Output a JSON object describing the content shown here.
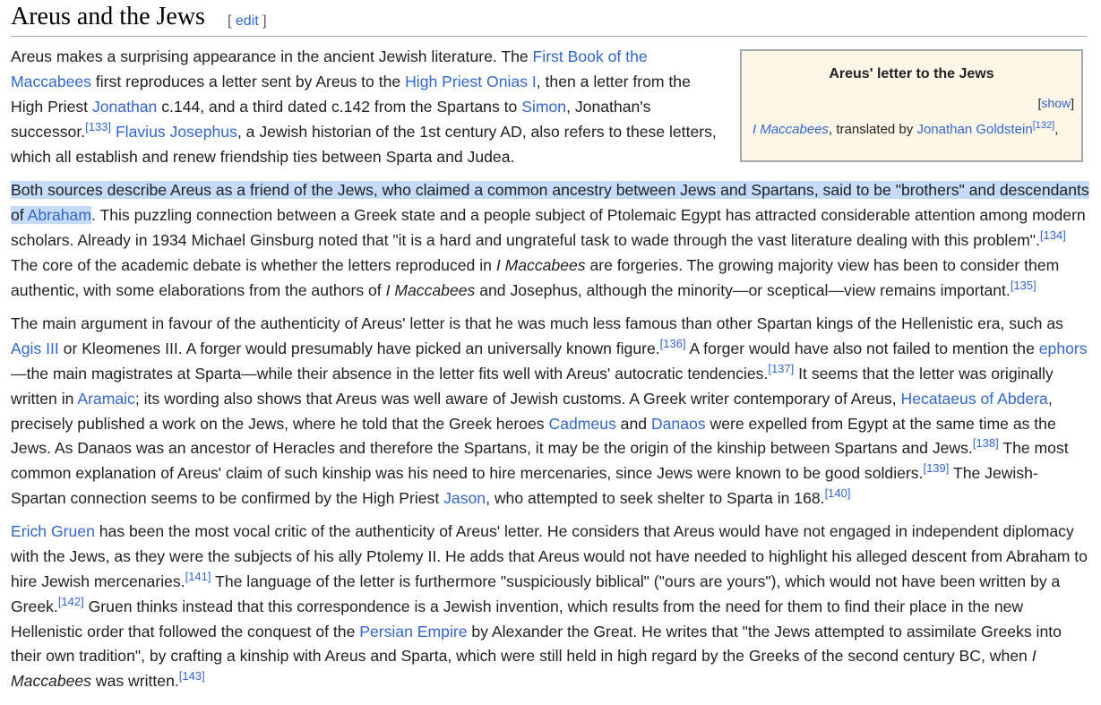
{
  "heading": {
    "title": "Areus and the Jews",
    "edit_open": "[",
    "edit_label": "edit",
    "edit_close": "]"
  },
  "quote_box": {
    "title": "Areus' letter to the Jews",
    "toggle_open": "[",
    "toggle_label": "show",
    "toggle_close": "]",
    "work": "I Maccabees",
    "translated_by": ", translated by ",
    "translator": "Jonathan Goldstein",
    "ref": "[132]",
    "trail": ","
  },
  "p1": {
    "l1": {
      "t1": "Areus makes a surprising appearance in the ancient Jewish literature. The ",
      "a1": "First Book of the"
    },
    "l2": {
      "a1": "Maccabees",
      "t1": " first reproduces a letter sent by Areus to the ",
      "a2": "High Priest Onias I",
      "t2": ", then a letter from the"
    },
    "l3": {
      "t1": "High Priest ",
      "a1": "Jonathan",
      "t2": " c.144, and a third dated c.142 from the Spartans to ",
      "a2": "Simon",
      "t3": ", Jonathan's"
    },
    "l4": {
      "t1": "successor.",
      "r1": "[133]",
      "t2": " ",
      "a1": "Flavius Josephus",
      "t3": ", a Jewish historian of the 1st century AD, also refers to these letters,"
    },
    "l5": {
      "t1": "which all establish and renew friendship ties between Sparta and Judea."
    }
  },
  "p2": {
    "l1": {
      "t1": "Both sources describe Areus as a friend of the Jews, who claimed a common ancestry between Jews and Spartans, said to be \"brothers\" and descendants"
    },
    "l2": {
      "t1": "of ",
      "a1": "Abraham",
      "t2": ". This puzzling connection between a Greek state and a people subject of Ptolemaic Egypt has attracted considerable attention among modern"
    },
    "l3": {
      "t1": "scholars. Already in 1934 Michael Ginsburg noted that \"it is a hard and ungrateful task to wade through the vast literature dealing with this problem\".",
      "r1": "[134]"
    },
    "l4": {
      "t1": "The core of the academic debate is whether the letters reproduced in ",
      "i1": "I Maccabees",
      "t2": " are forgeries. The growing majority view has been to consider them"
    },
    "l5": {
      "t1": "authentic, with some elaborations from the authors of ",
      "i1": "I Maccabees",
      "t2": " and Josephus, although the minority—or sceptical—view remains important.",
      "r1": "[135]"
    }
  },
  "p3": {
    "l1": {
      "t1": "The main argument in favour of the authenticity of Areus' letter is that he was much less famous than other Spartan kings of the Hellenistic era, such as"
    },
    "l2": {
      "a1": "Agis III",
      "t1": " or Kleomenes III. A forger would presumably have picked an universally known figure.",
      "r1": "[136]",
      "t2": " A forger would have also not failed to mention the ",
      "a2": "ephors"
    },
    "l3": {
      "t1": "—the main magistrates at Sparta—while their absence in the letter fits well with Areus' autocratic tendencies.",
      "r1": "[137]",
      "t2": " It seems that the letter was originally"
    },
    "l4": {
      "t1": "written in ",
      "a1": "Aramaic",
      "t2": "; its wording also shows that Areus was well aware of Jewish customs. A Greek writer contemporary of Areus, ",
      "a2": "Hecataeus of Abdera",
      "t3": ","
    },
    "l5": {
      "t1": "precisely published a work on the Jews, where he told that the Greek heroes ",
      "a1": "Cadmeus",
      "t2": " and ",
      "a2": "Danaos",
      "t3": " were expelled from Egypt at the same time as the"
    },
    "l6": {
      "t1": "Jews. As Danaos was an ancestor of Heracles and therefore the Spartans, it may be the origin of the kinship between Spartans and Jews.",
      "r1": "[138]",
      "t2": " The most"
    },
    "l7": {
      "t1": "common explanation of Areus' claim of such kinship was his need to hire mercenaries, since Jews were known to be good soldiers.",
      "r1": "[139]",
      "t2": " The Jewish-"
    },
    "l8": {
      "t1": "Spartan connection seems to be confirmed by the High Priest ",
      "a1": "Jason",
      "t2": ", who attempted to seek shelter to Sparta in 168.",
      "r1": "[140]"
    }
  },
  "p4": {
    "l1": {
      "a1": "Erich Gruen",
      "t1": " has been the most vocal critic of the authenticity of Areus' letter. He considers that Areus would have not engaged in independent diplomacy"
    },
    "l2": {
      "t1": "with the Jews, as they were the subjects of his ally Ptolemy II. He adds that Areus would not have needed to highlight his alleged descent from Abraham to"
    },
    "l3": {
      "t1": "hire Jewish mercenaries.",
      "r1": "[141]",
      "t2": " The language of the letter is furthermore \"suspiciously biblical\" (\"ours are yours\"), which would not have been written by a"
    },
    "l4": {
      "t1": "Greek.",
      "r1": "[142]",
      "t2": " Gruen thinks instead that this correspondence is a Jewish invention, which results from the need for them to find their place in the new"
    },
    "l5": {
      "t1": "Hellenistic order that followed the conquest of the ",
      "a1": "Persian Empire",
      "t2": " by Alexander the Great. He writes that \"the Jews attempted to assimilate Greeks into"
    },
    "l6": {
      "t1": "their own tradition\", by crafting a kinship with Areus and Sparta, which were still held in high regard by the Greeks of the second century BC, when ",
      "i1": "I"
    },
    "l7": {
      "i1": "Maccabees",
      "t1": " was written.",
      "r1": "[143]"
    }
  },
  "colors": {
    "link": "#3366cc",
    "text": "#202122",
    "selection": "#c6dbf7",
    "box_bg": "#fef6e7",
    "box_border": "#a2a9b1"
  }
}
